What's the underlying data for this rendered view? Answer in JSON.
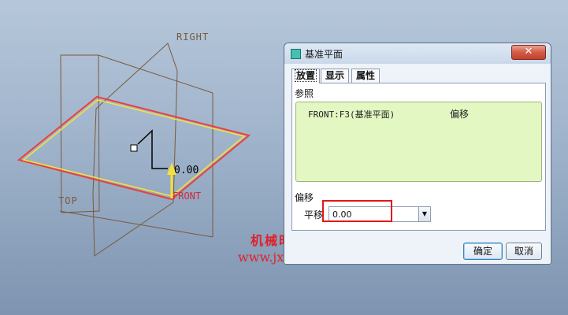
{
  "viewport": {
    "labels": {
      "right": "RIGHT",
      "top": "TOP",
      "front": "FRONT",
      "offset_dim": "0.00"
    },
    "colors": {
      "datum_plane": "#7a5a3c",
      "new_plane_outline": "#e84040",
      "new_plane_inner": "#f4e23a",
      "arrow": "#f4e23a"
    }
  },
  "watermark": {
    "line1": "机械时代网",
    "line2": "www.jxage.com"
  },
  "dialog": {
    "title": "基准平面",
    "close_glyph": "✕",
    "tabs": [
      "放置",
      "显示",
      "属性"
    ],
    "active_tab": "放置",
    "references_label": "参照",
    "reference_item": "FRONT:F3(基准平面)",
    "reference_type": "偏移",
    "offset_section_label": "偏移",
    "translate_label": "平移",
    "translate_value": "0.00",
    "ok_label": "确定",
    "cancel_label": "取消"
  }
}
